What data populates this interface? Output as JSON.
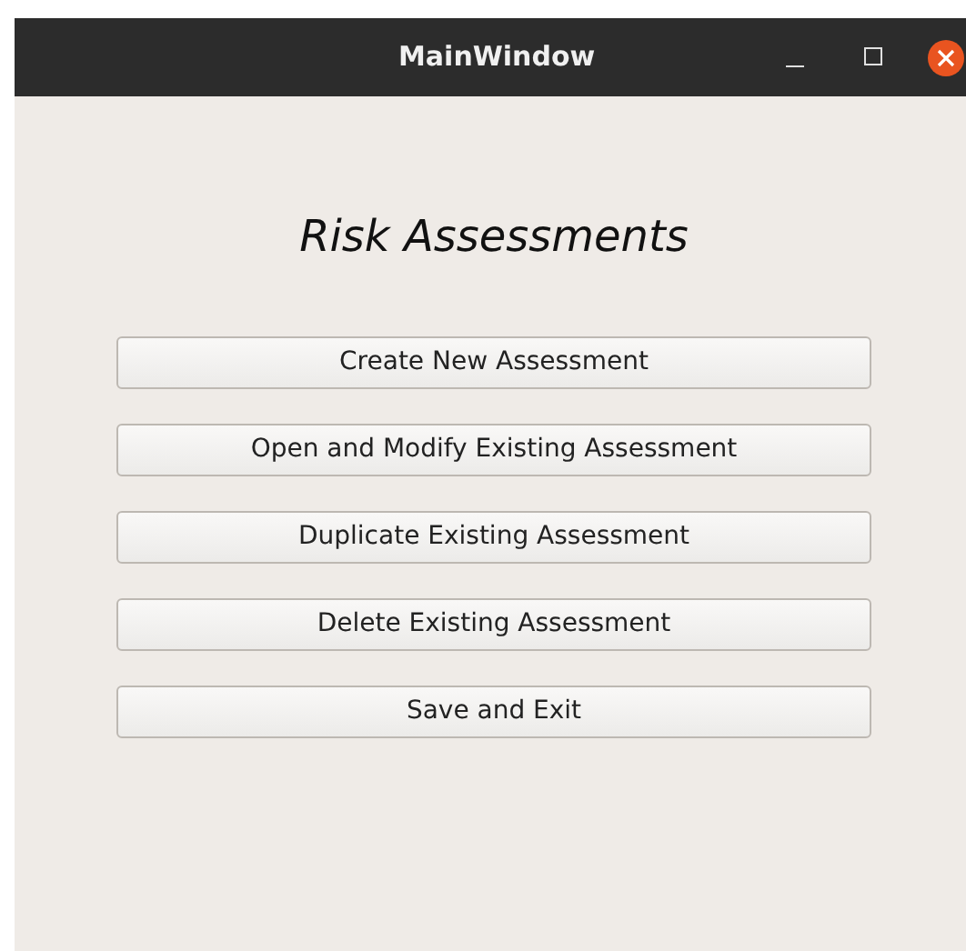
{
  "window": {
    "title": "MainWindow"
  },
  "heading": "Risk Assessments",
  "buttons": [
    "Create New Assessment",
    "Open and Modify Existing Assessment",
    "Duplicate Existing Assessment",
    "Delete Existing Assessment",
    "Save and Exit"
  ]
}
